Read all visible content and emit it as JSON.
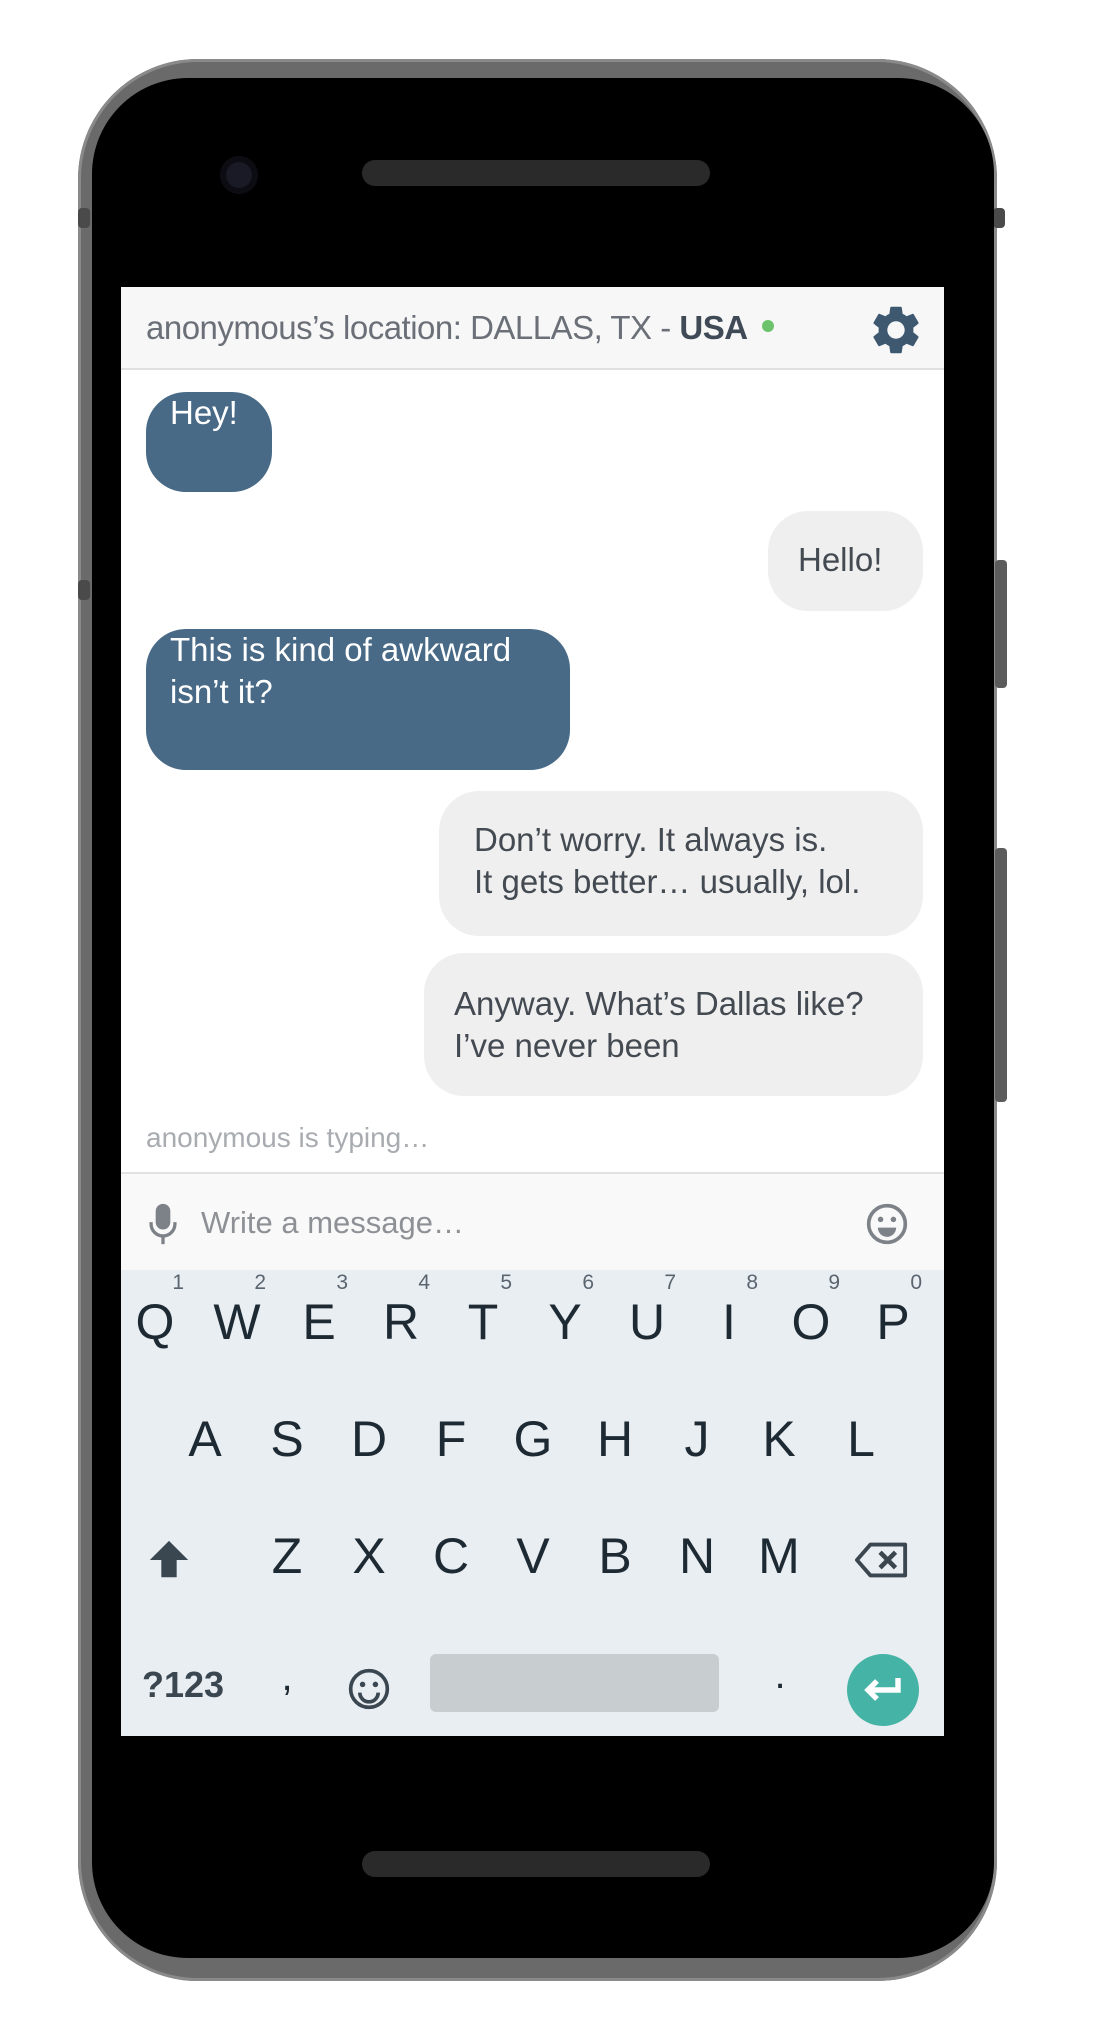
{
  "header": {
    "location_prefix": "anonymous’s location: DALLAS, TX - ",
    "country": "USA",
    "settings_icon": "gear-icon",
    "status_color": "#6cc36c"
  },
  "messages": [
    {
      "side": "in",
      "text": "Hey!"
    },
    {
      "side": "out",
      "text": "Hello!"
    },
    {
      "side": "in",
      "text": "This is kind of awkward\nisn’t it?"
    },
    {
      "side": "out",
      "text": "Don’t worry. It always is.\nIt gets better… usually, lol."
    },
    {
      "side": "out",
      "text": "Anyway. What’s Dallas like?\nI’ve never been"
    }
  ],
  "typing_indicator": "anonymous is typing…",
  "composer": {
    "placeholder": "Write a message…",
    "mic_icon": "microphone-icon",
    "emoji_icon": "smiley-icon"
  },
  "keyboard": {
    "row1": [
      {
        "key": "Q",
        "hint": "1"
      },
      {
        "key": "W",
        "hint": "2"
      },
      {
        "key": "E",
        "hint": "3"
      },
      {
        "key": "R",
        "hint": "4"
      },
      {
        "key": "T",
        "hint": "5"
      },
      {
        "key": "Y",
        "hint": "6"
      },
      {
        "key": "U",
        "hint": "7"
      },
      {
        "key": "I",
        "hint": "8"
      },
      {
        "key": "O",
        "hint": "9"
      },
      {
        "key": "P",
        "hint": "0"
      }
    ],
    "row2": [
      "A",
      "S",
      "D",
      "F",
      "G",
      "H",
      "J",
      "K",
      "L"
    ],
    "row3": [
      "Z",
      "X",
      "C",
      "V",
      "B",
      "N",
      "M"
    ],
    "symbols_key": "?123",
    "comma_key": ",",
    "period_key": ".",
    "accent_color": "#45b3a5"
  }
}
